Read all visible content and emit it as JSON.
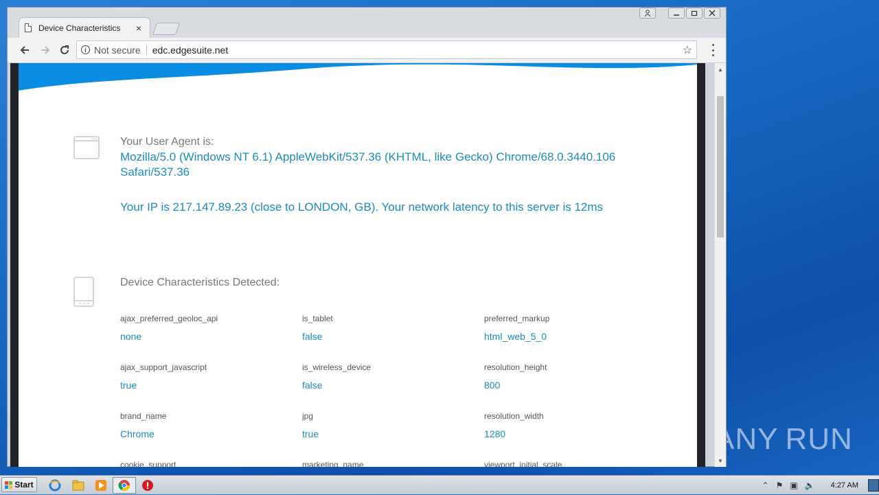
{
  "browser": {
    "tab_title": "Device Characteristics",
    "tab_close": "×",
    "security_label": "Not secure",
    "url": "edc.edgesuite.net"
  },
  "page": {
    "ua_heading": "Your User Agent is:",
    "ua_value": "Mozilla/5.0 (Windows NT 6.1) AppleWebKit/537.36 (KHTML, like Gecko) Chrome/68.0.3440.106 Safari/537.36",
    "ip_line": "Your IP is 217.147.89.23 (close to LONDON, GB). Your network latency to this server is 12ms",
    "dc_heading": "Device Characteristics Detected:",
    "characteristics": [
      {
        "key": "ajax_preferred_geoloc_api",
        "value": "none"
      },
      {
        "key": "is_tablet",
        "value": "false"
      },
      {
        "key": "preferred_markup",
        "value": "html_web_5_0"
      },
      {
        "key": "ajax_support_javascript",
        "value": "true"
      },
      {
        "key": "is_wireless_device",
        "value": "false"
      },
      {
        "key": "resolution_height",
        "value": "800"
      },
      {
        "key": "brand_name",
        "value": "Chrome"
      },
      {
        "key": "jpg",
        "value": "true"
      },
      {
        "key": "resolution_width",
        "value": "1280"
      },
      {
        "key": "cookie_support",
        "value": ""
      },
      {
        "key": "marketing_name",
        "value": ""
      },
      {
        "key": "viewport_initial_scale",
        "value": ""
      }
    ]
  },
  "taskbar": {
    "start_label": "Start",
    "clock": "4:27 AM"
  },
  "watermark": {
    "text_left": "ANY",
    "text_right": "RUN"
  },
  "colors": {
    "accent": "#1a8cbf",
    "wave": "#0a8ce3"
  }
}
